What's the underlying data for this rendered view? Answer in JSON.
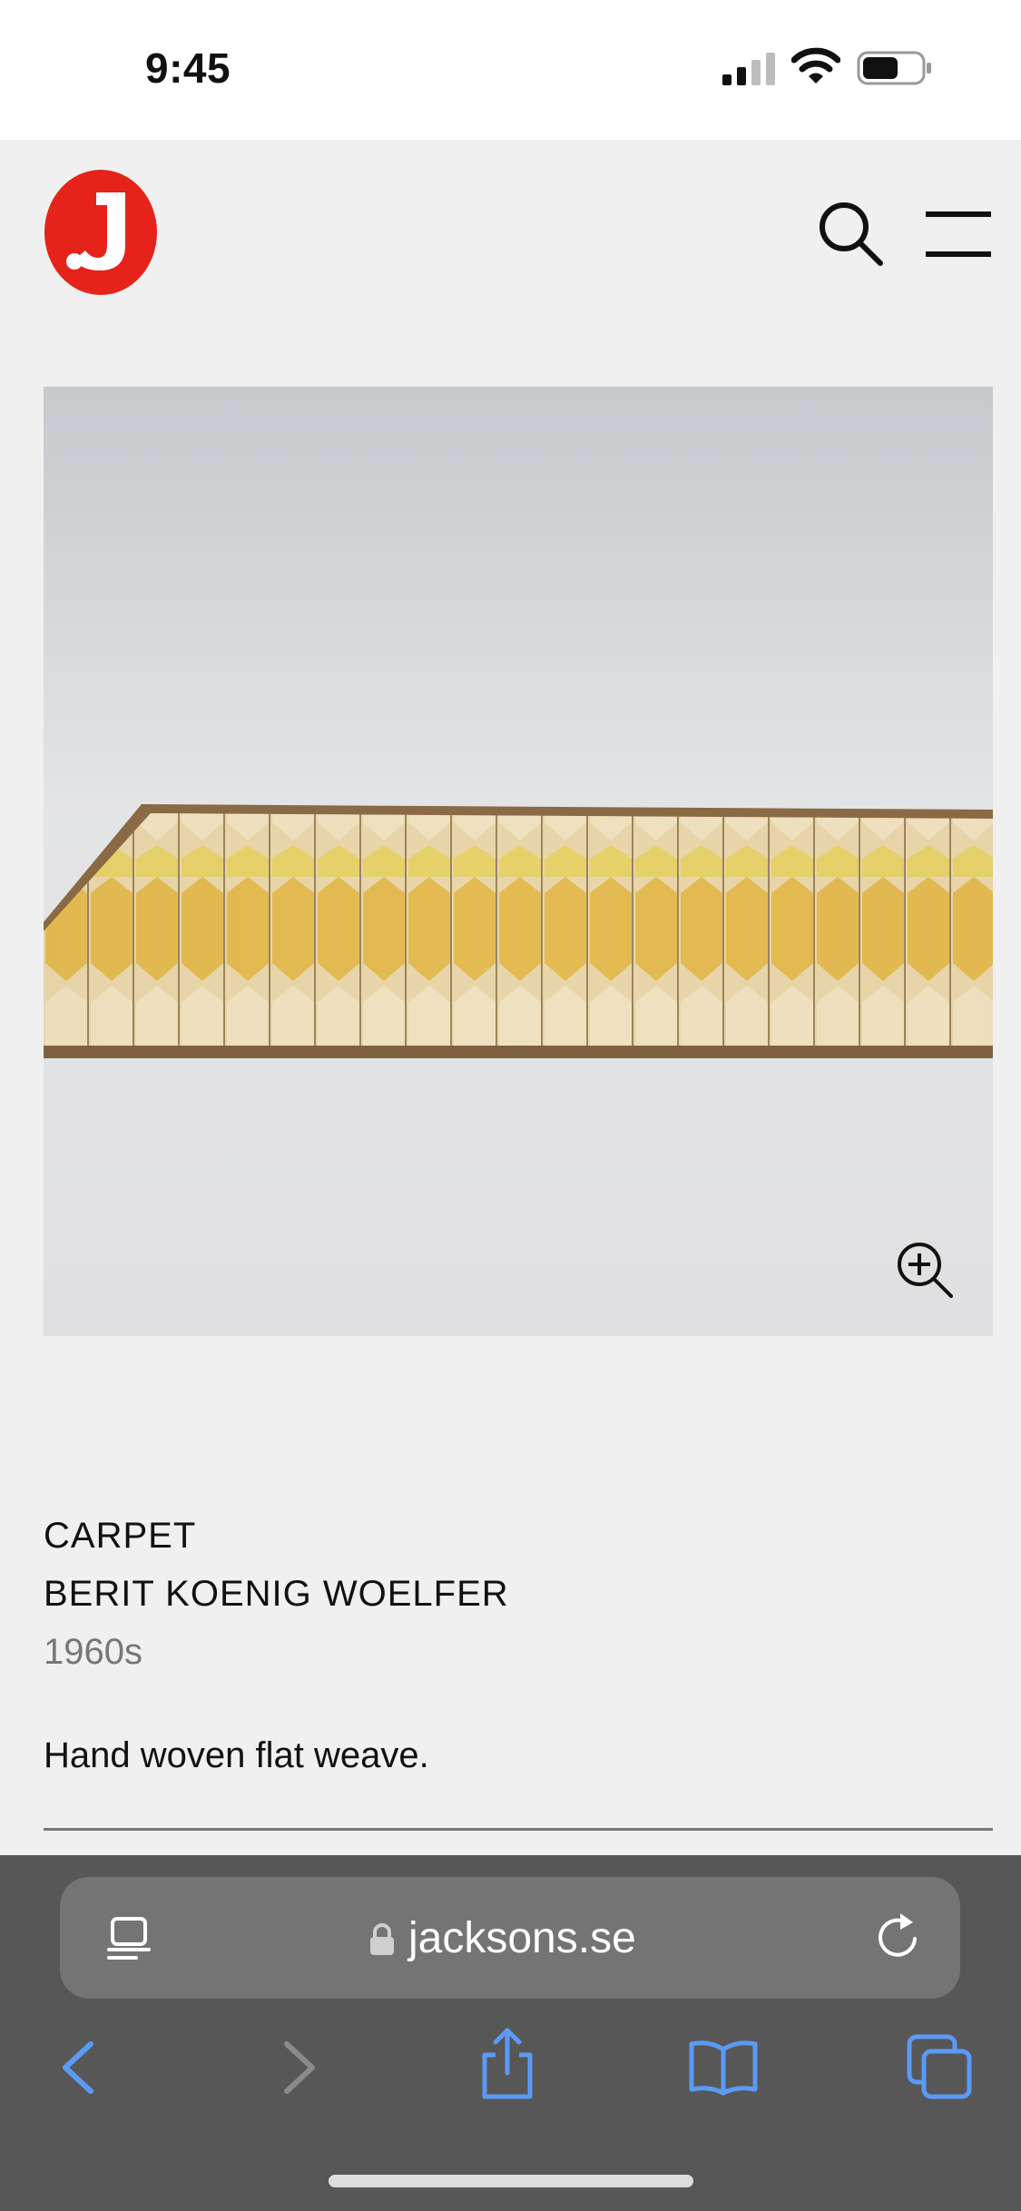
{
  "status_bar": {
    "time": "9:45"
  },
  "header": {
    "logo_letter": "J",
    "icons": [
      "search-icon",
      "menu-icon"
    ],
    "brand_color": "#e5231b"
  },
  "product": {
    "image_alt": "Carpet photo",
    "category": "CARPET",
    "artist": "BERIT KOENIG WOELFER",
    "year": "1960s",
    "description": "Hand woven flat weave."
  },
  "safari": {
    "url": "jacksons.se",
    "icons": [
      "reader-icon",
      "lock-icon",
      "reload-icon",
      "back-icon",
      "forward-icon",
      "share-icon",
      "bookmarks-icon",
      "tabs-icon"
    ],
    "accent_color": "#5b9af5"
  }
}
